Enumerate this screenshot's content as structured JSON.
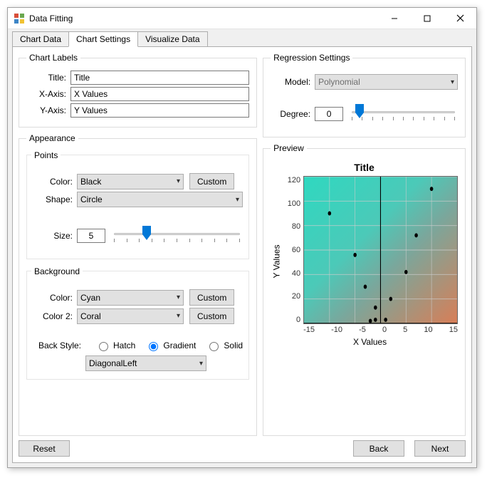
{
  "window": {
    "title": "Data Fitting"
  },
  "tabs": [
    "Chart Data",
    "Chart Settings",
    "Visualize Data"
  ],
  "active_tab": 1,
  "chart_labels": {
    "legend": "Chart Labels",
    "title_label": "Title:",
    "title_value": "Title",
    "xaxis_label": "X-Axis:",
    "xaxis_value": "X Values",
    "yaxis_label": "Y-Axis:",
    "yaxis_value": "Y Values"
  },
  "appearance": {
    "legend": "Appearance",
    "points": {
      "legend": "Points",
      "color_label": "Color:",
      "color_value": "Black",
      "custom_label": "Custom",
      "shape_label": "Shape:",
      "shape_value": "Circle",
      "size_label": "Size:",
      "size_value": "5"
    },
    "background": {
      "legend": "Background",
      "color_label": "Color:",
      "color_value": "Cyan",
      "color2_label": "Color 2:",
      "color2_value": "Coral",
      "custom_label": "Custom",
      "backstyle_label": "Back Style:",
      "hatch_label": "Hatch",
      "gradient_label": "Gradient",
      "solid_label": "Solid",
      "direction_value": "DiagonalLeft",
      "selected_style": "Gradient"
    }
  },
  "regression": {
    "legend": "Regression Settings",
    "model_label": "Model:",
    "model_value": "Polynomial",
    "degree_label": "Degree:",
    "degree_value": "0"
  },
  "preview": {
    "legend": "Preview"
  },
  "footer": {
    "reset_label": "Reset",
    "back_label": "Back",
    "next_label": "Next"
  },
  "chart_data": {
    "type": "scatter",
    "title": "Title",
    "xlabel": "X Values",
    "ylabel": "Y Values",
    "xlim": [
      -15,
      15
    ],
    "ylim": [
      0,
      120
    ],
    "xticks": [
      -15,
      -10,
      -5,
      0,
      5,
      10,
      15
    ],
    "yticks": [
      0,
      20,
      40,
      60,
      80,
      100,
      120
    ],
    "points": [
      {
        "x": -10,
        "y": 90
      },
      {
        "x": -5,
        "y": 56
      },
      {
        "x": -3,
        "y": 30
      },
      {
        "x": -2,
        "y": 2
      },
      {
        "x": -1,
        "y": 3
      },
      {
        "x": -1,
        "y": 13
      },
      {
        "x": 1,
        "y": 3
      },
      {
        "x": 2,
        "y": 20
      },
      {
        "x": 5,
        "y": 42
      },
      {
        "x": 7,
        "y": 72
      },
      {
        "x": 10,
        "y": 110
      }
    ]
  }
}
